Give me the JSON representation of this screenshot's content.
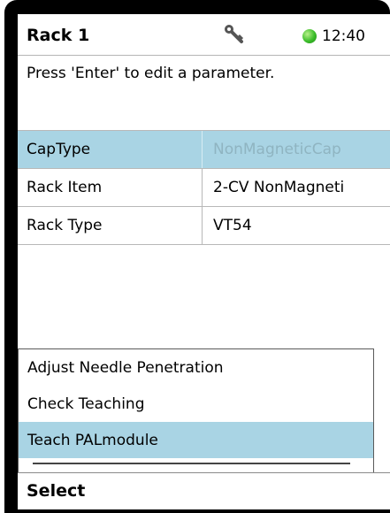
{
  "header": {
    "title": "Rack 1",
    "time": "12:40",
    "icons": [
      "key-icon",
      "status-indicator-icon"
    ],
    "status_color": "#3bbd2a"
  },
  "instruction": "Press 'Enter' to edit a parameter.",
  "parameters": [
    {
      "name": "CapType",
      "value": "NonMagneticCap",
      "selected": true
    },
    {
      "name": "Rack Item",
      "value": "2-CV NonMagneti",
      "selected": false
    },
    {
      "name": "Rack Type",
      "value": "VT54",
      "selected": false
    }
  ],
  "menu": {
    "items": [
      {
        "label": "Adjust Needle Penetration",
        "selected": false
      },
      {
        "label": "Check Teaching",
        "selected": false
      },
      {
        "label": "Teach PALmodule",
        "selected": true
      }
    ]
  },
  "softkey": {
    "label": "Select"
  },
  "colors": {
    "selection": "#a9d4e4",
    "disabled_text": "#8fb4c1"
  }
}
